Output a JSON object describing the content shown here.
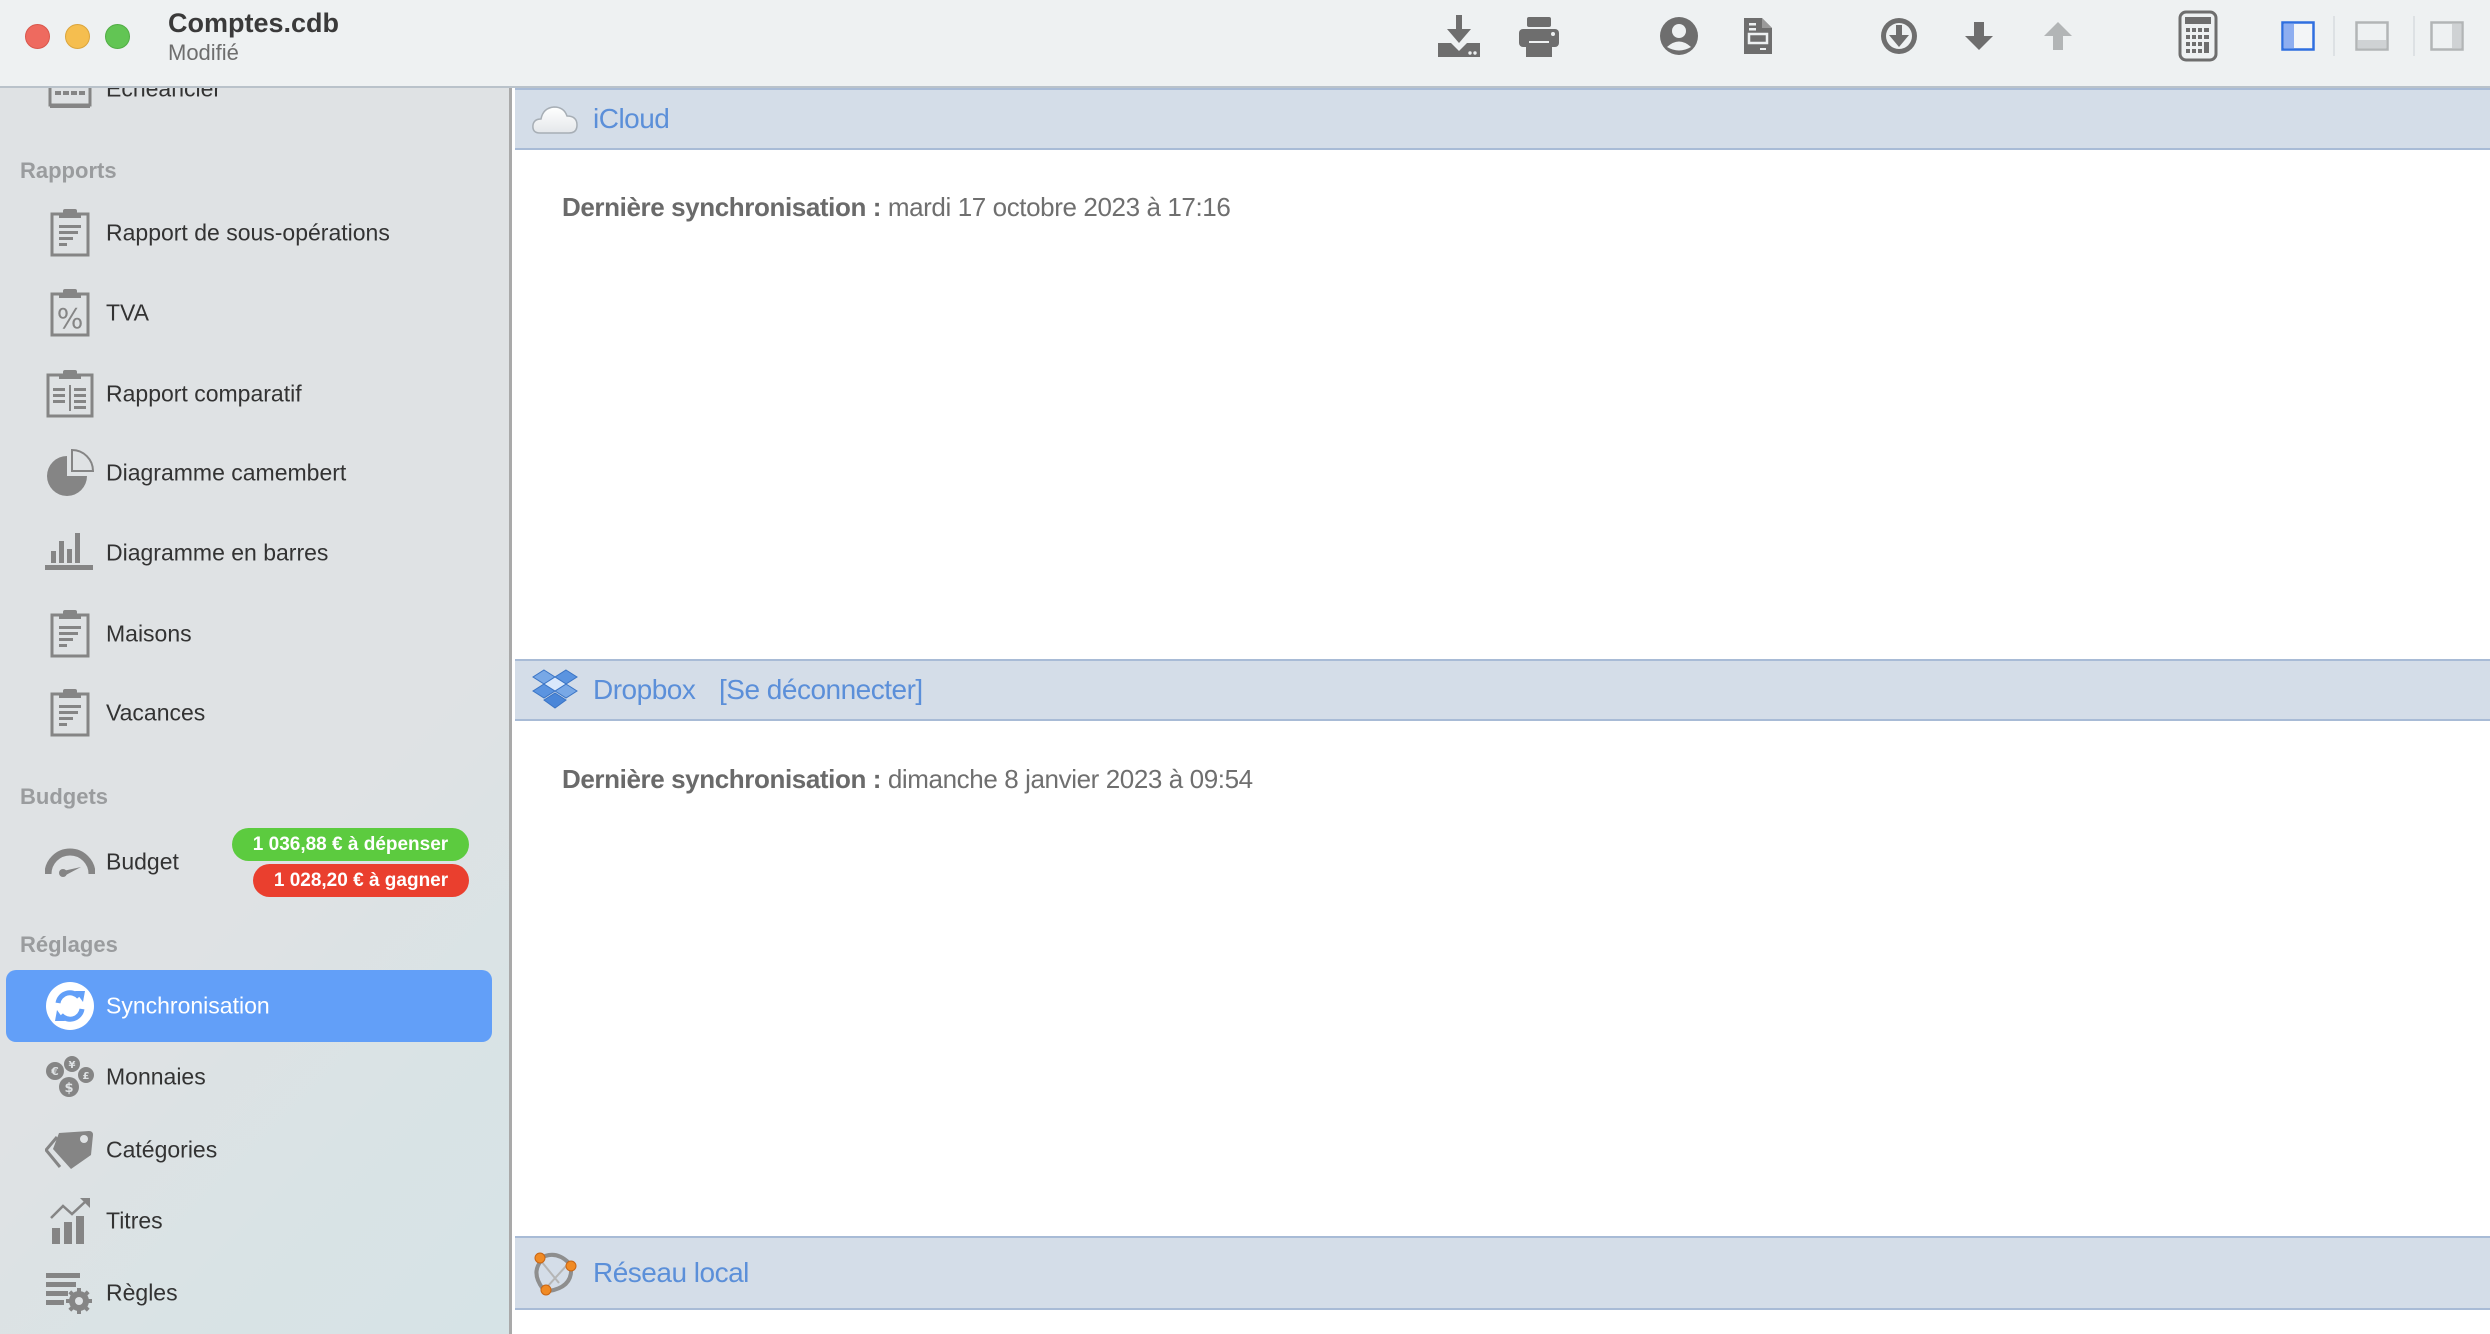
{
  "window": {
    "title": "Comptes.cdb",
    "subtitle": "Modifié",
    "traffic_lights": [
      "close",
      "minimize",
      "zoom"
    ]
  },
  "toolbar": {
    "buttons": [
      {
        "name": "import",
        "icon": "tray-download-icon",
        "enabled": true
      },
      {
        "name": "print",
        "icon": "printer-icon",
        "enabled": true
      },
      {
        "name": "account",
        "icon": "user-circle-icon",
        "enabled": true
      },
      {
        "name": "report",
        "icon": "document-icon",
        "enabled": true
      },
      {
        "name": "download-sync",
        "icon": "circle-arrow-down-icon",
        "enabled": true
      },
      {
        "name": "move-down",
        "icon": "arrow-down-icon",
        "enabled": true
      },
      {
        "name": "move-up",
        "icon": "arrow-up-icon",
        "enabled": false
      },
      {
        "name": "calculator",
        "icon": "calculator-icon",
        "enabled": true
      },
      {
        "name": "layout-sidebar",
        "icon": "layout-left-panel-icon",
        "active": true
      },
      {
        "name": "layout-bottom",
        "icon": "layout-bottom-panel-icon",
        "active": false
      },
      {
        "name": "layout-right",
        "icon": "layout-right-panel-icon",
        "active": false
      }
    ]
  },
  "sidebar": {
    "top_item": {
      "label": "Échéancier",
      "icon": "calendar-icon"
    },
    "sections": [
      {
        "title": "Rapports",
        "items": [
          {
            "label": "Rapport de sous-opérations",
            "icon": "clipboard-list-icon"
          },
          {
            "label": "TVA",
            "icon": "clipboard-percent-icon"
          },
          {
            "label": "Rapport comparatif",
            "icon": "clipboard-compare-icon"
          },
          {
            "label": "Diagramme camembert",
            "icon": "pie-chart-icon"
          },
          {
            "label": "Diagramme en barres",
            "icon": "bar-chart-icon"
          },
          {
            "label": "Maisons",
            "icon": "clipboard-list-icon"
          },
          {
            "label": "Vacances",
            "icon": "clipboard-list-icon"
          }
        ]
      },
      {
        "title": "Budgets",
        "items": [
          {
            "label": "Budget",
            "icon": "gauge-icon",
            "badges": [
              {
                "text": "1 036,88 € à dépenser",
                "color": "#5ccb3f"
              },
              {
                "text": "1 028,20 € à gagner",
                "color": "#ea3f2e"
              }
            ]
          }
        ]
      },
      {
        "title": "Réglages",
        "items": [
          {
            "label": "Synchronisation",
            "icon": "sync-icon",
            "selected": true
          },
          {
            "label": "Monnaies",
            "icon": "currencies-icon"
          },
          {
            "label": "Catégories",
            "icon": "tag-icon"
          },
          {
            "label": "Titres",
            "icon": "stocks-chart-icon"
          },
          {
            "label": "Règles",
            "icon": "rules-gear-icon"
          }
        ]
      }
    ]
  },
  "main": {
    "services": [
      {
        "name": "iCloud",
        "icon": "cloud-icon",
        "link": null,
        "last_sync_label": "Dernière synchronisation :",
        "last_sync_value": "mardi 17 octobre 2023 à 17:16"
      },
      {
        "name": "Dropbox",
        "icon": "dropbox-icon",
        "link": "[Se déconnecter]",
        "last_sync_label": "Dernière synchronisation :",
        "last_sync_value": "dimanche 8 janvier 2023 à 09:54"
      },
      {
        "name": "Réseau local",
        "icon": "local-network-icon",
        "link": null
      }
    ]
  },
  "colors": {
    "accent": "#629ff8",
    "header_link": "#5b8fd9",
    "section_band": "#d4dde8",
    "badge_spend": "#5ccb3f",
    "badge_earn": "#ea3f2e"
  }
}
